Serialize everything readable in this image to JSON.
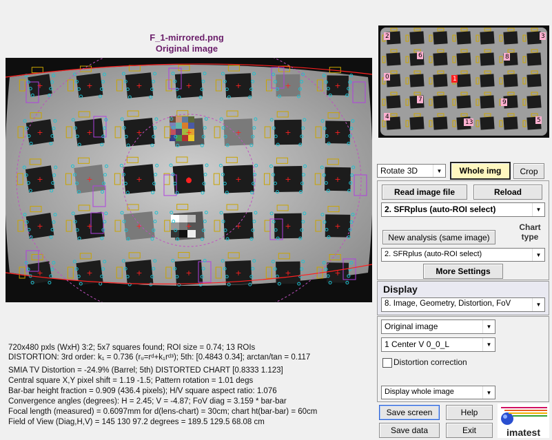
{
  "image": {
    "filename": "F_1-mirrored.png",
    "caption": "Original image"
  },
  "thumb_roi_labels": [
    "2",
    "3",
    "6",
    "8",
    "0",
    "1",
    "7",
    "9",
    "4",
    "13",
    "5"
  ],
  "stats_lines": [
    "720x480 pxls (WxH) 3:2;   5x7 squares found;   ROI size = 0.74;   13 ROIs",
    "DISTORTION:  3rd order:  k₁ = 0.736  (rᵤ=rᵈ+k₁rᵈ³);   5th: [0.4843  0.34];   arctan/tan = 0.117",
    "SMIA TV Distortion = -24.9%  (Barrel; 5th)    DISTORTED CHART [0.8333 1.123]",
    "Central square X,Y pixel shift = 1.19  -1.5;   Pattern rotation = 1.01 degs",
    "Bar-bar height fraction = 0.909  (436.4 pixels);  H/V square aspect ratio: 1.076",
    "Convergence angles (degrees):  H = 2.45;  V = -4.87;   FoV diag = 3.159 * bar-bar",
    "Focal length (measured) = 0.6097mm  for d(lens-chart) = 30cm;  chart ht(bar-bar) = 60cm",
    "Field of View (Diag,H,V) = 145      130      97.2 degrees  =  189.5      129.5      68.08 cm"
  ],
  "controls": {
    "rotate_select": "Rotate 3D",
    "whole_img_button": "Whole img",
    "crop_button": "Crop",
    "read_image_button": "Read image file",
    "reload_button": "Reload",
    "analysis_select": "2. SFRplus (auto-ROI select)",
    "new_analysis_button": "New analysis (same image)",
    "chart_type_label_1": "Chart",
    "chart_type_label_2": "type",
    "chart_type_select": "2. SFRplus (auto-ROI select)",
    "more_settings_button": "More Settings",
    "display_label": "Display",
    "display_select": "8.   Image, Geometry, Distortion, FoV",
    "image_select": "Original image",
    "center_select": "1  Center  V     0_0_L",
    "distortion_checkbox_label": "Distortion correction",
    "display_whole_select": "Display whole image",
    "save_screen_button": "Save screen",
    "help_button": "Help",
    "save_data_button": "Save data",
    "exit_button": "Exit",
    "logo_text": "imatest"
  },
  "colors": {
    "title": "#6a1e6a",
    "roi_yellow": "#c9a400",
    "roi_purple": "#b040e0",
    "marker_red": "#ff2020",
    "marker_cyan": "#20c0d0",
    "highlight_bg": "#fff7c0"
  }
}
